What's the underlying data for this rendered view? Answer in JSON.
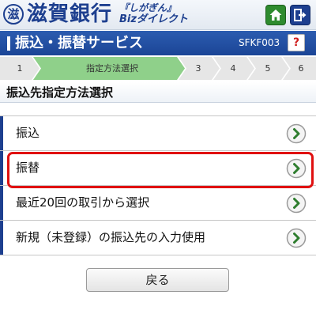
{
  "header": {
    "logo_glyph": "滋",
    "bank_name": "滋賀銀行",
    "brand_top": "『しがぎん』",
    "brand_bottom": "Bizダイレクト",
    "home_icon": "home-icon",
    "logout_icon": "logout-icon",
    "colors": {
      "brand": "#1d3f8f",
      "home": "#2e8b2e"
    }
  },
  "title_bar": {
    "title": "振込・振替サービス",
    "screen_id": "SFKF003",
    "help_label": "?"
  },
  "steps": {
    "current": 2,
    "items": [
      {
        "label": "1"
      },
      {
        "label": "指定方法選択"
      },
      {
        "label": "3"
      },
      {
        "label": "4"
      },
      {
        "label": "5"
      },
      {
        "label": "6"
      }
    ],
    "colors": {
      "active": "#8fd08a",
      "inactive": "#e6e6e6"
    }
  },
  "section": {
    "heading": "振込先指定方法選択"
  },
  "menu": {
    "items": [
      {
        "label": "振込",
        "icon": "chevron-right-icon"
      },
      {
        "label": "振替",
        "icon": "chevron-right-icon",
        "highlighted": true
      },
      {
        "label": "最近20回の取引から選択",
        "icon": "chevron-right-icon"
      },
      {
        "label": "新規（未登録）の振込先の入力使用",
        "icon": "chevron-right-icon"
      }
    ],
    "highlight_color": "#e01010"
  },
  "footer": {
    "back_label": "戻る"
  }
}
